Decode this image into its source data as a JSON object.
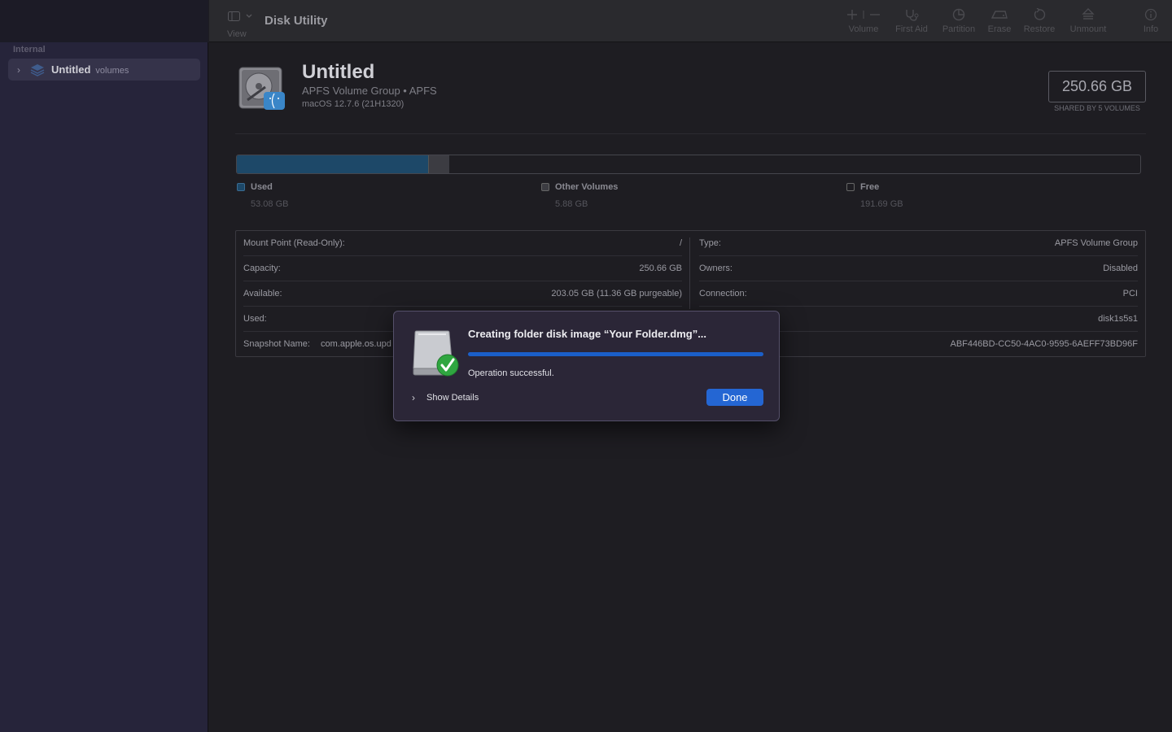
{
  "app": {
    "title": "Disk Utility"
  },
  "toolbar": {
    "view_label": "View",
    "tools": [
      {
        "label": "Volume",
        "icon": "plus-minus-icon"
      },
      {
        "label": "First Aid",
        "icon": "stethoscope-icon"
      },
      {
        "label": "Partition",
        "icon": "pie-chart-icon"
      },
      {
        "label": "Erase",
        "icon": "eraser-icon"
      },
      {
        "label": "Restore",
        "icon": "restore-icon"
      },
      {
        "label": "Unmount",
        "icon": "eject-icon"
      },
      {
        "label": "Info",
        "icon": "info-icon"
      }
    ]
  },
  "sidebar": {
    "section": "Internal",
    "items": [
      {
        "label": "Untitled",
        "sublabel": "volumes",
        "icon": "volume-stack-icon",
        "selected": true
      }
    ]
  },
  "volume": {
    "name": "Untitled",
    "subtitle": "APFS Volume Group • APFS",
    "os": "macOS 12.7.6 (21H1320)",
    "capacity": "250.66 GB",
    "shared_note": "SHARED BY 5 VOLUMES"
  },
  "usage": {
    "capacity_gb": 250.66,
    "segments": [
      {
        "name": "Used",
        "value": "53.08 GB",
        "gb": 53.08,
        "color": "#1d4868"
      },
      {
        "name": "Other Volumes",
        "value": "5.88 GB",
        "gb": 5.88,
        "color": "#3c3c42"
      },
      {
        "name": "Free",
        "value": "191.69 GB",
        "gb": 191.69,
        "color": "#1e1d22"
      }
    ]
  },
  "info": {
    "left": [
      {
        "key": "Mount Point (Read-Only):",
        "value": "/"
      },
      {
        "key": "Capacity:",
        "value": "250.66 GB"
      },
      {
        "key": "Available:",
        "value": "203.05 GB (11.36 GB purgeable)"
      },
      {
        "key": "Used:",
        "value": ""
      },
      {
        "key": "Snapshot Name:",
        "value": "com.apple.os.upd"
      }
    ],
    "right": [
      {
        "key": "Type:",
        "value": "APFS Volume Group"
      },
      {
        "key": "Owners:",
        "value": "Disabled"
      },
      {
        "key": "Connection:",
        "value": "PCI"
      },
      {
        "key": "",
        "value": "disk1s5s1"
      },
      {
        "key": "",
        "value": "ABF446BD-CC50-4AC0-9595-6AEFF73BD96F"
      }
    ]
  },
  "dialog": {
    "title": "Creating folder disk image “Your Folder.dmg”...",
    "progress": 1.0,
    "status": "Operation successful.",
    "details_label": "Show Details",
    "done_label": "Done"
  }
}
